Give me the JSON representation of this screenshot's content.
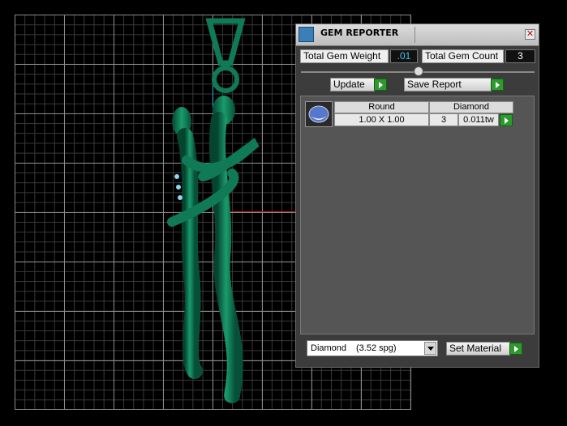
{
  "panel": {
    "title": "GEM REPORTER",
    "close_symbol": "✕",
    "total_gem_weight_label": "Total Gem Weight",
    "total_gem_weight_value": ".01",
    "total_gem_count_label": "Total Gem Count",
    "total_gem_count_value": "3",
    "update_label": "Update",
    "save_report_label": "Save Report",
    "table": {
      "headers": [
        "Round",
        "Diamond"
      ],
      "row": {
        "size": "1.00 X 1.00",
        "count": "3",
        "weight": "0.011tw"
      }
    },
    "material": {
      "name": "Diamond",
      "sg": "(3.52 spg)"
    },
    "set_material_label": "Set Material"
  },
  "icons": [
    "gem-reporter-app-icon",
    "close-icon",
    "round-gem-icon",
    "arrow-right-icon",
    "dropdown-arrow-icon"
  ],
  "colors": {
    "model": "#0f7a55",
    "value_cyan": "#3fc6e8",
    "go_green": "#2e9a2e",
    "axis_red": "#d41a1a"
  }
}
